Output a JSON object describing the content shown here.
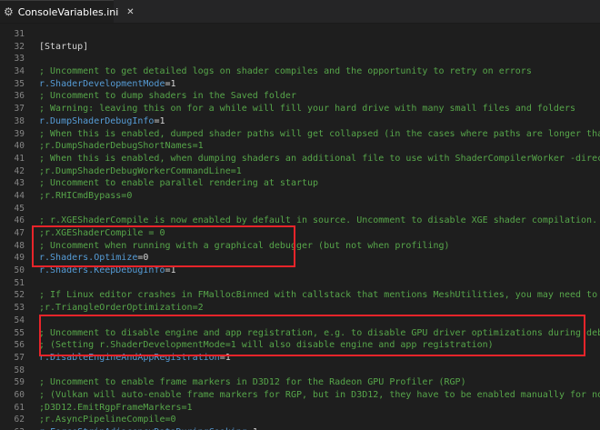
{
  "tab": {
    "icon": "gear-icon",
    "title": "ConsoleVariables.ini",
    "close_glyph": "✕"
  },
  "colors": {
    "highlight": "#e8242a",
    "comment": "#57a64a",
    "key": "#569cd6"
  },
  "lines": [
    {
      "n": "31",
      "type": "blank",
      "text": ""
    },
    {
      "n": "32",
      "type": "section",
      "text": "[Startup]"
    },
    {
      "n": "33",
      "type": "blank",
      "text": ""
    },
    {
      "n": "34",
      "type": "comment",
      "text": "; Uncomment to get detailed logs on shader compiles and the opportunity to retry on errors"
    },
    {
      "n": "35",
      "type": "kv",
      "key": "r.ShaderDevelopmentMode",
      "value": "1"
    },
    {
      "n": "36",
      "type": "comment",
      "text": "; Uncomment to dump shaders in the Saved folder"
    },
    {
      "n": "37",
      "type": "comment",
      "text": "; Warning: leaving this on for a while will fill your hard drive with many small files and folders"
    },
    {
      "n": "38",
      "type": "kv",
      "key": "r.DumpShaderDebugInfo",
      "value": "1"
    },
    {
      "n": "39",
      "type": "comment",
      "text": "; When this is enabled, dumped shader paths will get collapsed (in the cases where paths are longer than the OS's"
    },
    {
      "n": "40",
      "type": "comment",
      "text": ";r.DumpShaderDebugShortNames=1"
    },
    {
      "n": "41",
      "type": "comment",
      "text": "; When this is enabled, when dumping shaders an additional file to use with ShaderCompilerWorker -direct mode will"
    },
    {
      "n": "42",
      "type": "comment",
      "text": ";r.DumpShaderDebugWorkerCommandLine=1"
    },
    {
      "n": "43",
      "type": "comment",
      "text": "; Uncomment to enable parallel rendering at startup"
    },
    {
      "n": "44",
      "type": "comment",
      "text": ";r.RHICmdBypass=0"
    },
    {
      "n": "45",
      "type": "blank",
      "text": ""
    },
    {
      "n": "46",
      "type": "comment",
      "text": "; r.XGEShaderCompile is now enabled by default in source. Uncomment to disable XGE shader compilation."
    },
    {
      "n": "47",
      "type": "comment",
      "text": ";r.XGEShaderCompile = 0"
    },
    {
      "n": "48",
      "type": "comment",
      "text": "; Uncomment when running with a graphical debugger (but not when profiling)"
    },
    {
      "n": "49",
      "type": "kv",
      "key": "r.Shaders.Optimize",
      "value": "0"
    },
    {
      "n": "50",
      "type": "kv",
      "key": "r.Shaders.KeepDebugInfo",
      "value": "1"
    },
    {
      "n": "51",
      "type": "blank",
      "text": ""
    },
    {
      "n": "52",
      "type": "comment",
      "text": "; If Linux editor crashes in FMallocBinned with callstack that mentions MeshUtilities, you may need to uncomment"
    },
    {
      "n": "53",
      "type": "comment",
      "text": ";r.TriangleOrderOptimization=2"
    },
    {
      "n": "54",
      "type": "blank",
      "text": ""
    },
    {
      "n": "55",
      "type": "comment",
      "text": "; Uncomment to disable engine and app registration, e.g. to disable GPU driver optimizations during debugging and"
    },
    {
      "n": "56",
      "type": "comment",
      "text": "; (Setting r.ShaderDevelopmentMode=1 will also disable engine and app registration)"
    },
    {
      "n": "57",
      "type": "kv",
      "key": "r.DisableEngineAndAppRegistration",
      "value": "1"
    },
    {
      "n": "58",
      "type": "blank",
      "text": ""
    },
    {
      "n": "59",
      "type": "comment",
      "text": "; Uncomment to enable frame markers in D3D12 for the Radeon GPU Profiler (RGP)"
    },
    {
      "n": "60",
      "type": "comment",
      "text": "; (Vulkan will auto-enable frame markers for RGP, but in D3D12, they have to be enabled manually for now.)"
    },
    {
      "n": "61",
      "type": "comment",
      "text": ";D3D12.EmitRgpFrameMarkers=1"
    },
    {
      "n": "62",
      "type": "comment",
      "text": ";r.AsyncPipelineCompile=0"
    },
    {
      "n": "63",
      "type": "kv",
      "key": "r.ForceStripAdjacencyDataDuringCooking",
      "value": "1"
    }
  ]
}
